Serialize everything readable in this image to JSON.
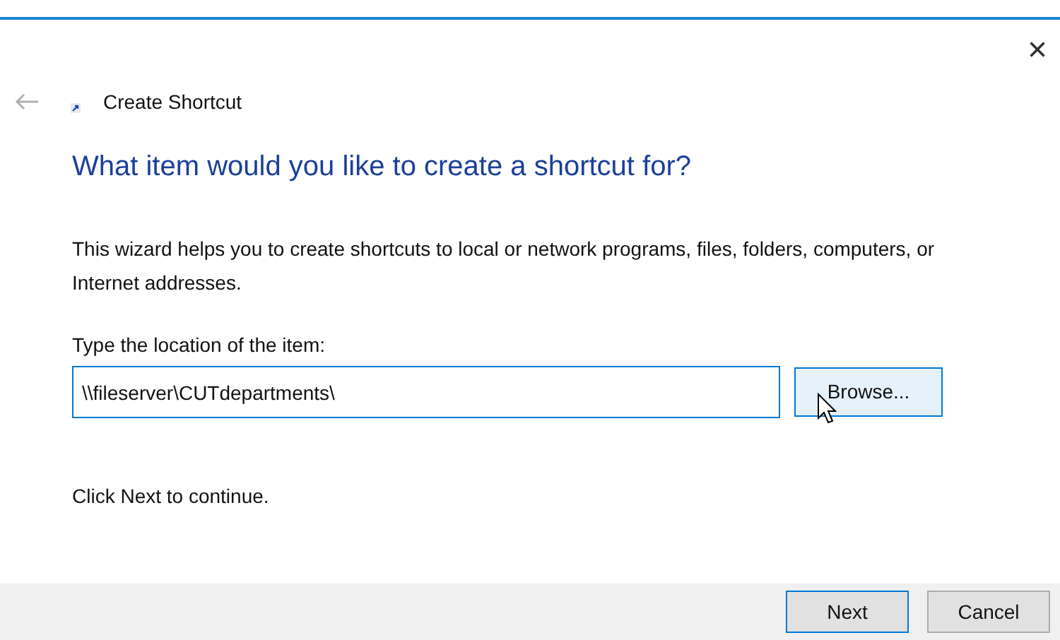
{
  "window": {
    "title": "Create Shortcut",
    "close": "×"
  },
  "heading": "What item would you like to create a shortcut for?",
  "description": "This wizard helps you to create shortcuts to local or network programs, files, folders, computers, or Internet addresses.",
  "location": {
    "label": "Type the location of the item:",
    "value": "\\\\fileserver\\CUTdepartments\\",
    "browse": {
      "label": "Browse...",
      "hovered": true
    }
  },
  "hint": "Click Next to continue.",
  "buttons": [
    {
      "label": "Next",
      "default": true
    },
    {
      "label": "Cancel",
      "default": false
    }
  ]
}
